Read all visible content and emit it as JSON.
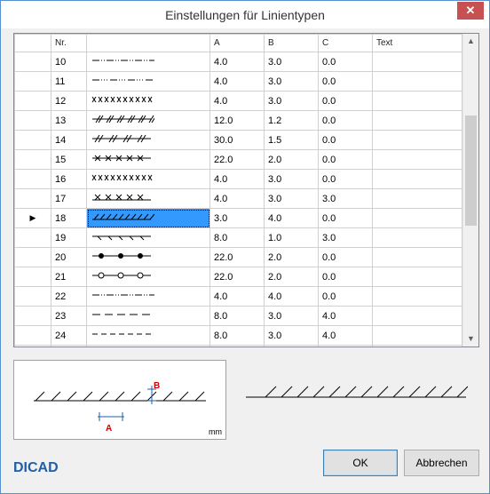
{
  "window": {
    "title": "Einstellungen für Linientypen",
    "close_glyph": "✕"
  },
  "grid": {
    "columns": [
      "",
      "Nr.",
      "",
      "A",
      "B",
      "C",
      "Text"
    ],
    "rows": [
      {
        "nr": "10",
        "a": "4.0",
        "b": "3.0",
        "c": "0.0",
        "pattern": "dash-dot-dot"
      },
      {
        "nr": "11",
        "a": "4.0",
        "b": "3.0",
        "c": "0.0",
        "pattern": "dash-dot-dot-dot"
      },
      {
        "nr": "12",
        "a": "4.0",
        "b": "3.0",
        "c": "0.0",
        "pattern": "x-marks"
      },
      {
        "nr": "13",
        "a": "12.0",
        "b": "1.2",
        "c": "0.0",
        "pattern": "double-slash"
      },
      {
        "nr": "14",
        "a": "30.0",
        "b": "1.5",
        "c": "0.0",
        "pattern": "slash-groups"
      },
      {
        "nr": "15",
        "a": "22.0",
        "b": "2.0",
        "c": "0.0",
        "pattern": "x-on-line"
      },
      {
        "nr": "16",
        "a": "4.0",
        "b": "3.0",
        "c": "0.0",
        "pattern": "x-dense"
      },
      {
        "nr": "17",
        "a": "4.0",
        "b": "3.0",
        "c": "3.0",
        "pattern": "x-offset"
      },
      {
        "nr": "18",
        "a": "3.0",
        "b": "4.0",
        "c": "0.0",
        "pattern": "hatch",
        "selected": true
      },
      {
        "nr": "19",
        "a": "8.0",
        "b": "1.0",
        "c": "3.0",
        "pattern": "ticks-down"
      },
      {
        "nr": "20",
        "a": "22.0",
        "b": "2.0",
        "c": "0.0",
        "pattern": "filled-dots"
      },
      {
        "nr": "21",
        "a": "22.0",
        "b": "2.0",
        "c": "0.0",
        "pattern": "open-dots"
      },
      {
        "nr": "22",
        "a": "4.0",
        "b": "4.0",
        "c": "0.0",
        "pattern": "dash-dot-dot"
      },
      {
        "nr": "23",
        "a": "8.0",
        "b": "3.0",
        "c": "4.0",
        "pattern": "long-dash"
      },
      {
        "nr": "24",
        "a": "8.0",
        "b": "3.0",
        "c": "4.0",
        "pattern": "dash-short"
      }
    ],
    "current_row_marker": "▶",
    "scroll_up_glyph": "▲",
    "scroll_down_glyph": "▼"
  },
  "preview": {
    "label_a": "A",
    "label_b": "B",
    "unit": "mm"
  },
  "logo": "DICAD",
  "buttons": {
    "ok": "OK",
    "cancel": "Abbrechen"
  },
  "colors": {
    "selection": "#3399ff",
    "close": "#c75050",
    "dimension_label": "#d00000",
    "dimension_line": "#1f5fa8"
  }
}
